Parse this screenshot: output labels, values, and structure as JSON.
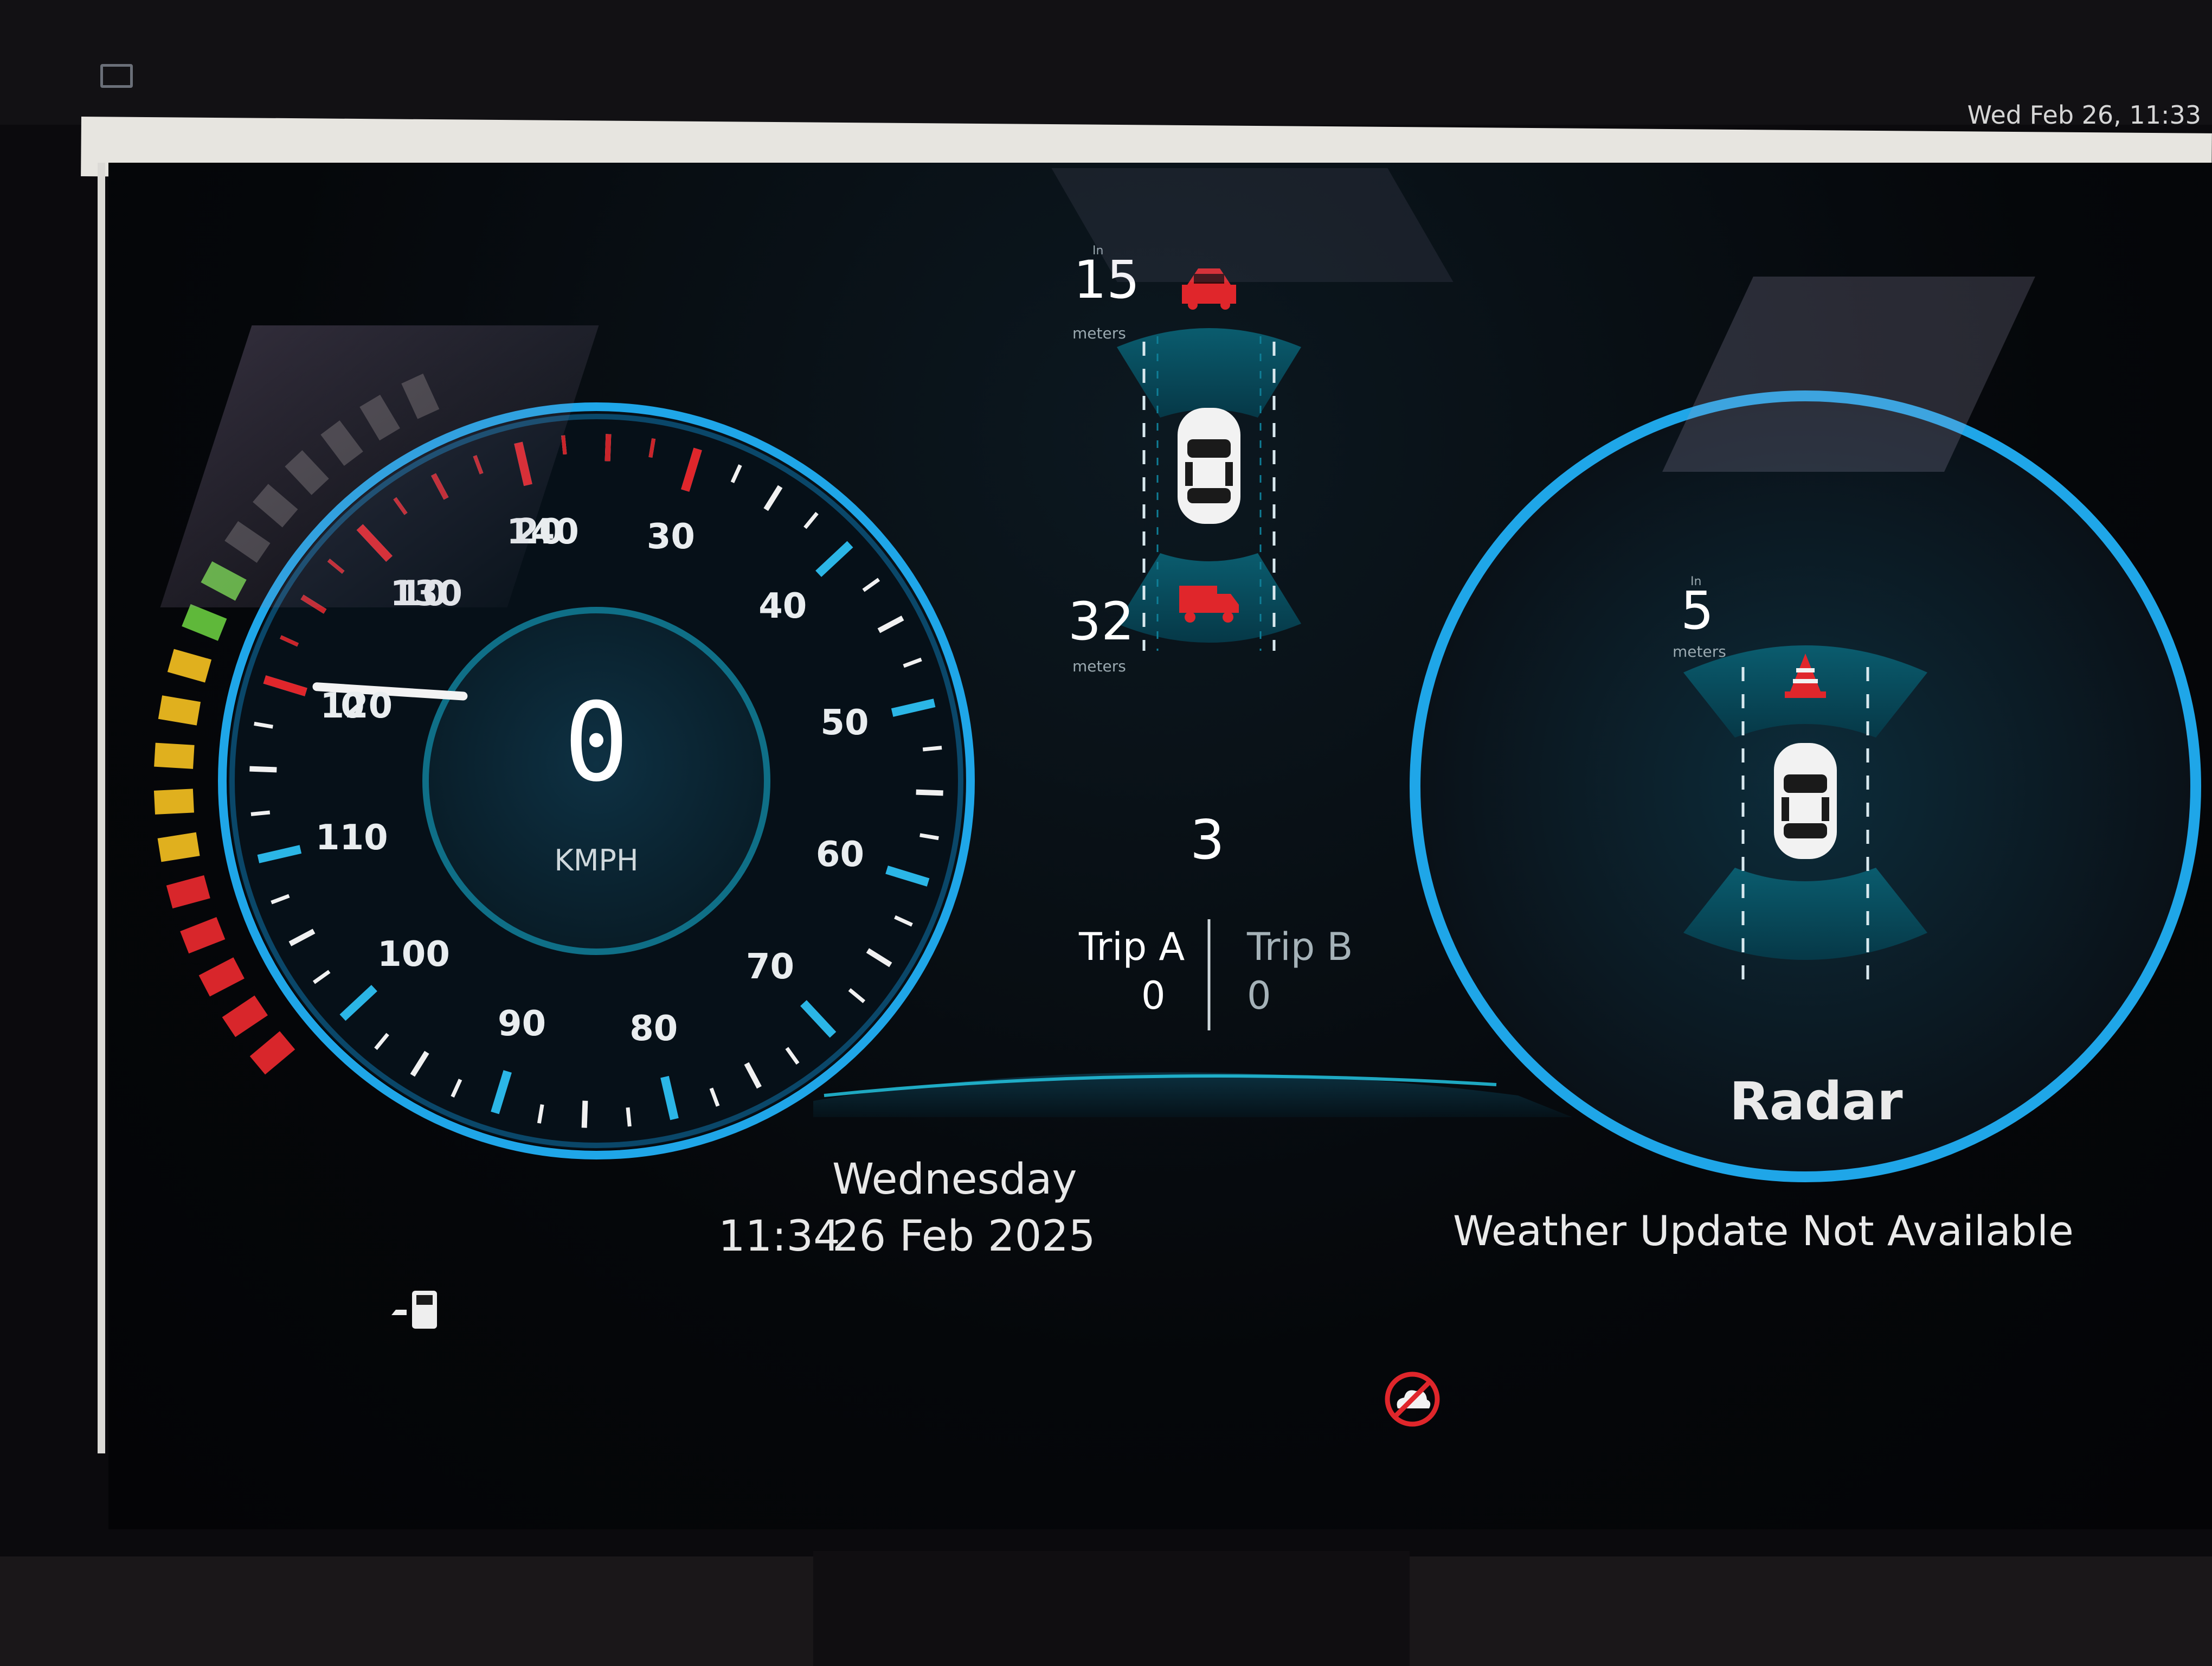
{
  "taskbar": {
    "clock": "Wed Feb 26, 11:33"
  },
  "speedometer": {
    "value": "0",
    "unit": "KMPH",
    "current_speed": 0,
    "ticks": [
      "0",
      "10",
      "20",
      "30",
      "40",
      "50",
      "60",
      "70",
      "80",
      "90",
      "100",
      "110",
      "120",
      "130",
      "140"
    ]
  },
  "fuel_gauge": {
    "segments_lit": 14,
    "segments_total": 18
  },
  "rear_radar": {
    "front_label": "In",
    "front_distance": "15",
    "front_unit": "meters",
    "rear_distance": "32",
    "rear_unit": "meters"
  },
  "gear": "3",
  "trip": {
    "a_label": "Trip A",
    "a_value": "0",
    "b_label": "Trip B",
    "b_value": "0"
  },
  "radar": {
    "label": "Radar",
    "distance_label": "In",
    "distance": "5",
    "distance_unit": "meters"
  },
  "datetime": {
    "day": "Wednesday",
    "time": "11:34",
    "date": "26 Feb 2025"
  },
  "weather": {
    "status": "Weather Update Not Available"
  },
  "colors": {
    "accent": "#1fa6e8",
    "warning": "#e0262b",
    "car": "#f2f2f2",
    "lane": "#0f7f98"
  }
}
